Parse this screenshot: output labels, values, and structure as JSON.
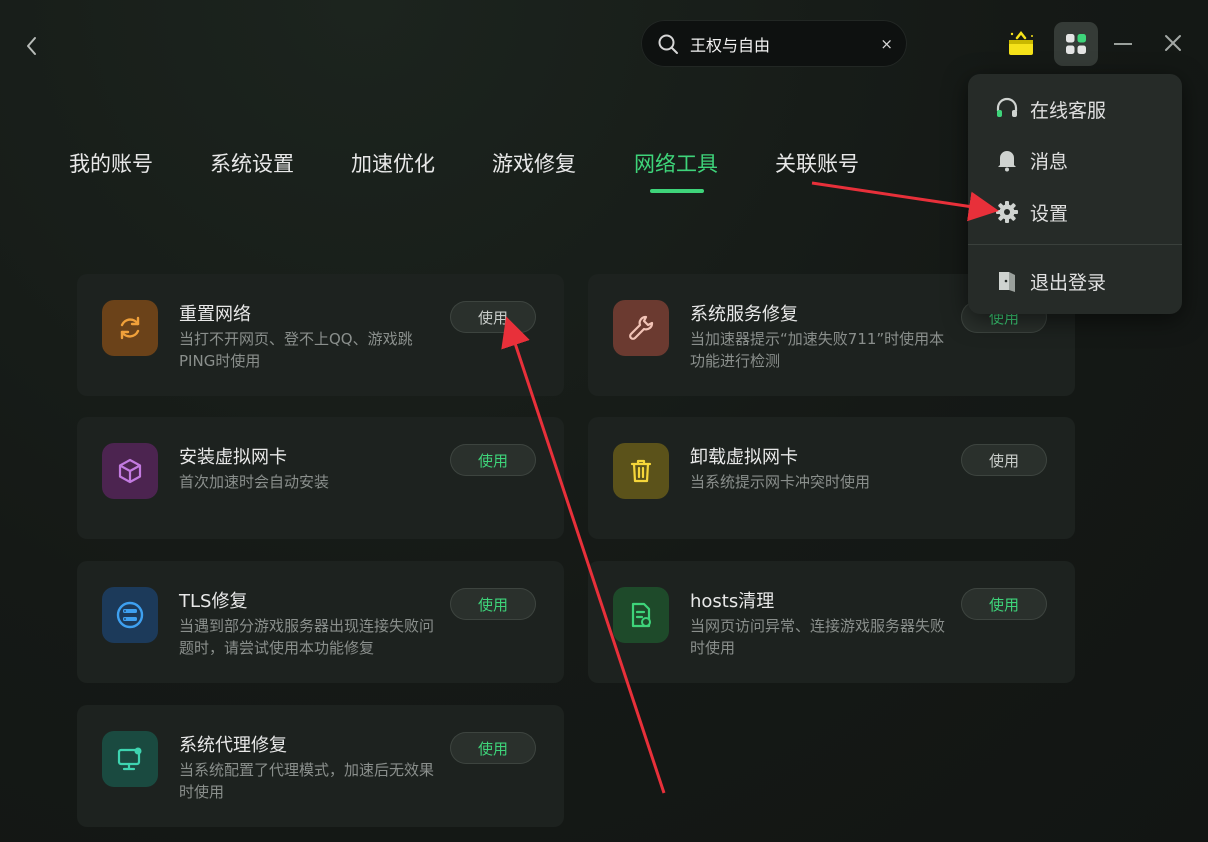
{
  "search": {
    "value": "王权与自由",
    "clear": "×"
  },
  "tabs": [
    {
      "label": "我的账号"
    },
    {
      "label": "系统设置"
    },
    {
      "label": "加速优化"
    },
    {
      "label": "游戏修复"
    },
    {
      "label": "网络工具",
      "active": true
    },
    {
      "label": "关联账号"
    }
  ],
  "tools": [
    {
      "title": "重置网络",
      "desc": "当打不开网页、登不上QQ、游戏跳PING时使用",
      "button": "使用",
      "icon": "refresh-icon",
      "icon_bg": "#6b4219",
      "icon_color": "#f0a03a"
    },
    {
      "title": "系统服务修复",
      "desc": "当加速器提示“加速失败711”时使用本功能进行检测",
      "button": "使用",
      "icon": "wrench-icon",
      "icon_bg": "#6b3a30",
      "icon_color": "#f2c3b6"
    },
    {
      "title": "安装虚拟网卡",
      "desc": "首次加速时会自动安装",
      "button": "使用",
      "icon": "cube-icon",
      "icon_bg": "#4c2450",
      "icon_color": "#c27ae0"
    },
    {
      "title": "卸载虚拟网卡",
      "desc": "当系统提示网卡冲突时使用",
      "button": "使用",
      "icon": "trash-icon",
      "icon_bg": "#5b521a",
      "icon_color": "#f5d63a"
    },
    {
      "title": "TLS修复",
      "desc": "当遇到部分游戏服务器出现连接失败问题时，请尝试使用本功能修复",
      "button": "使用",
      "icon": "tls-list-icon",
      "icon_bg": "#1c3a5a",
      "icon_color": "#3ea0f0"
    },
    {
      "title": "hosts清理",
      "desc": "当网页访问异常、连接游戏服务器失败时使用",
      "button": "使用",
      "icon": "file-clean-icon",
      "icon_bg": "#1e4a2a",
      "icon_color": "#3ed47a"
    },
    {
      "title": "系统代理修复",
      "desc": "当系统配置了代理模式，加速后无效果时使用",
      "button": "使用",
      "icon": "monitor-icon",
      "icon_bg": "#1a4a40",
      "icon_color": "#3ed4b0"
    }
  ],
  "menu": {
    "items": [
      {
        "label": "在线客服",
        "icon": "headset-icon"
      },
      {
        "label": "消息",
        "icon": "bell-icon"
      },
      {
        "label": "设置",
        "icon": "gear-icon"
      },
      {
        "label": "退出登录",
        "icon": "logout-icon"
      }
    ]
  },
  "colors": {
    "accent": "#3ed47a",
    "annotation": "#e8303a",
    "gift": "#f5e21a"
  }
}
